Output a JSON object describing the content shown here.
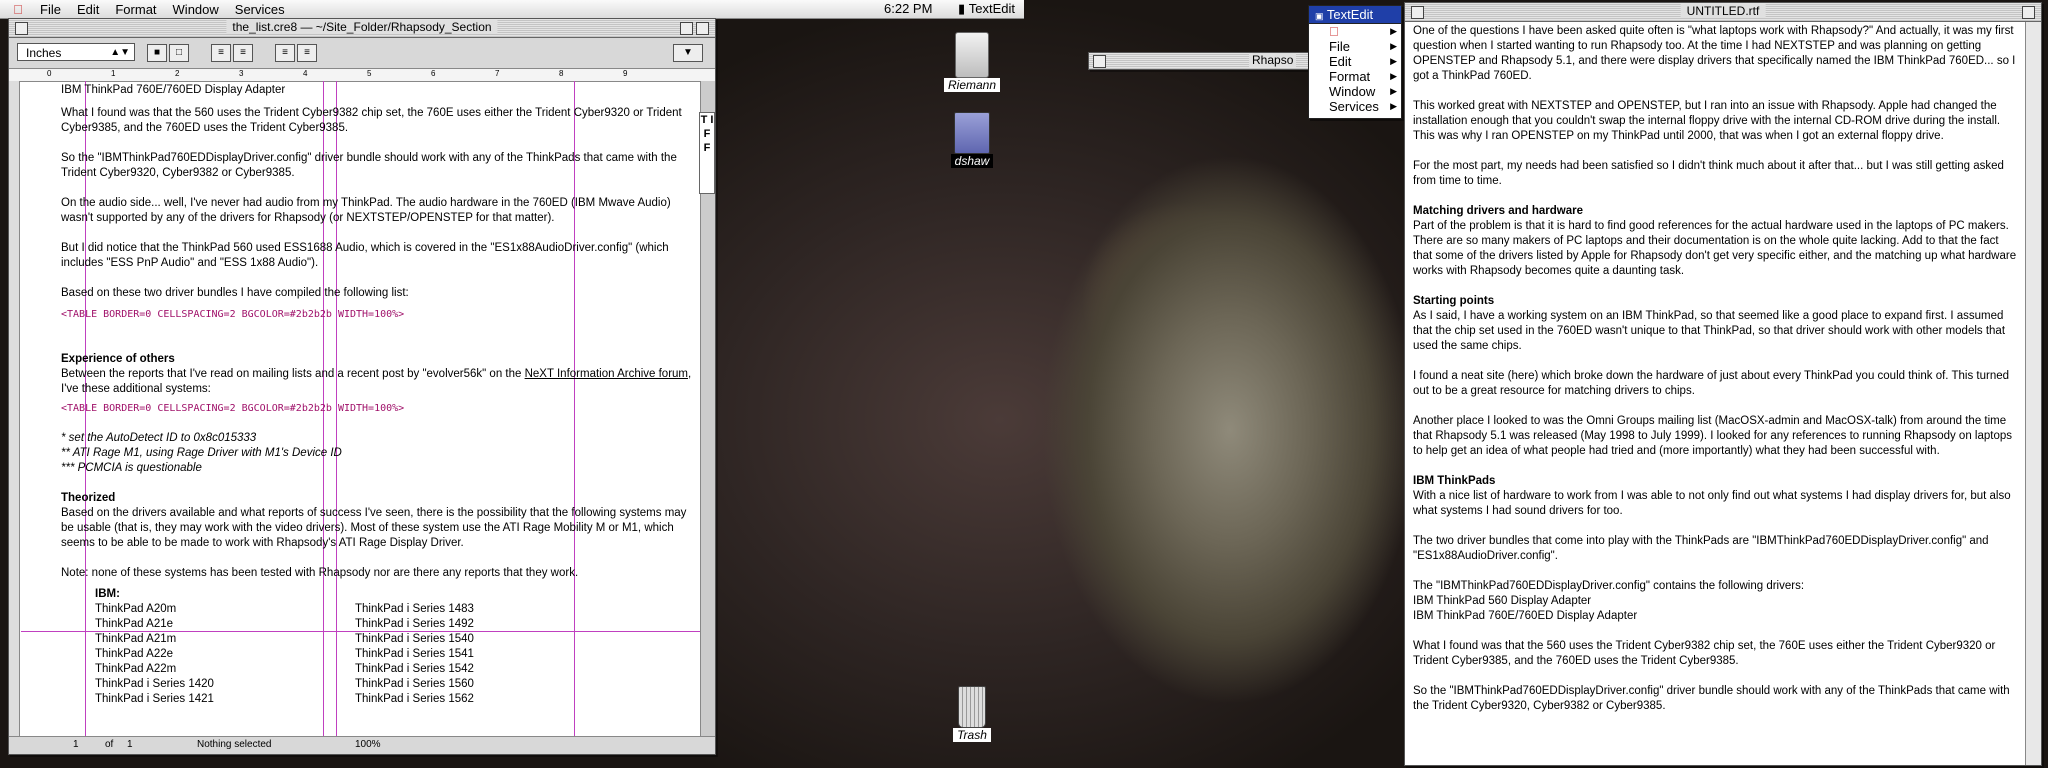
{
  "menubar": {
    "items": [
      "File",
      "Edit",
      "Format",
      "Window",
      "Services"
    ],
    "clock": "6:22 PM",
    "active_app": "TextEdit"
  },
  "editor": {
    "title": "the_list.cre8 — ~/Site_Folder/Rhapsody_Section",
    "units": "Inches",
    "ruler": [
      "0",
      "1",
      "2",
      "3",
      "4",
      "5",
      "6",
      "7",
      "8",
      "9"
    ],
    "tiff": "T I F F",
    "paragraphs": [
      "IBM ThinkPad 760E/760ED Display Adapter",
      "What I found was that the 560 uses the Trident Cyber9382 chip set, the 760E uses either the Trident Cyber9320 or Trident Cyber9385, and the 760ED uses the Trident Cyber9385.",
      "So the \"IBMThinkPad760EDDisplayDriver.config\" driver bundle should work with any of the ThinkPads that came with the Trident Cyber9320, Cyber9382 or Cyber9385.",
      "On the audio side... well, I've never had audio from my ThinkPad. The audio hardware in the 760ED (IBM Mwave Audio) wasn't supported by any of the drivers for Rhapsody (or NEXTSTEP/OPENSTEP for that matter).",
      "But I did notice that the ThinkPad 560 used ESS1688 Audio, which is covered in the \"ES1x88AudioDriver.config\" (which includes \"ESS PnP Audio\" and \"ESS 1x88 Audio\").",
      "Based on these two driver bundles I have compiled the following list:"
    ],
    "code1": "<TABLE BORDER=0 CELLSPACING=2 BGCOLOR=#2b2b2b WIDTH=100%>",
    "heading_others": "Experience of others",
    "others_text": "Between the reports that I've read on mailing lists and a recent post by \"evolver56k\" on the ",
    "others_link": "NeXT Information Archive forum",
    "others_tail": ", I've these additional systems:",
    "code2": "<TABLE BORDER=0 CELLSPACING=2 BGCOLOR=#2b2b2b WIDTH=100%>",
    "notes": [
      "* set the AutoDetect ID to 0x8c015333",
      "** ATI Rage M1, using Rage Driver with M1's Device ID",
      "*** PCMCIA is questionable"
    ],
    "heading_theorized": "Theorized",
    "theorized_text": "Based on the drivers available and what reports of success I've seen, there is the possibility that the following systems may be usable (that is, they may work with the video drivers). Most of these system use the ATI Rage Mobility M or M1, which seems to be able to be made to work with Rhapsody's ATI Rage Display Driver.",
    "note_text": "Note: none of these systems has been tested with Rhapsody nor are there any reports that they work.",
    "ibm_label": "IBM:",
    "ibm_col1": [
      "ThinkPad A20m",
      "ThinkPad A21e",
      "ThinkPad A21m",
      "ThinkPad A22e",
      "ThinkPad A22m",
      "ThinkPad i Series 1420",
      "ThinkPad i Series 1421"
    ],
    "ibm_col2": [
      "ThinkPad i Series 1483",
      "ThinkPad i Series 1492",
      "ThinkPad i Series 1540",
      "ThinkPad i Series 1541",
      "ThinkPad i Series 1542",
      "ThinkPad i Series 1560",
      "ThinkPad i Series 1562"
    ],
    "status": {
      "page": "1",
      "of": "of",
      "total": "1",
      "selection": "Nothing selected",
      "zoom": "100%"
    }
  },
  "desktop_icons": [
    {
      "label": "Riemann"
    },
    {
      "label": "dshaw"
    },
    {
      "label": "Trash"
    }
  ],
  "hidden_window_title": "Rhapso",
  "textedit_menu": {
    "header": "TextEdit",
    "items": [
      "File",
      "Edit",
      "Format",
      "Window",
      "Services"
    ]
  },
  "rtf": {
    "title": "UNTITLED.rtf",
    "blocks": [
      {
        "type": "p",
        "text": "One of the questions I have been asked quite often is \"what laptops work with Rhapsody?\" And actually, it was my first question when I started wanting to run Rhapsody too. At the time I had NEXTSTEP and was planning on getting OPENSTEP and Rhapsody 5.1, and there were display drivers that specifically named the IBM ThinkPad 760ED... so I got a ThinkPad 760ED."
      },
      {
        "type": "p",
        "text": "This worked great with NEXTSTEP and OPENSTEP, but I ran into an issue with Rhapsody. Apple had changed the installation enough that you couldn't swap the internal floppy drive with the internal CD-ROM drive during the install. This was why I ran OPENSTEP on my ThinkPad until 2000, that was when I got an external floppy drive."
      },
      {
        "type": "p",
        "text": "For the most part, my needs had been satisfied so I didn't think much about it after that... but I was still getting asked from time to time."
      },
      {
        "type": "h",
        "text": "Matching drivers and hardware"
      },
      {
        "type": "p",
        "text": "Part of the problem is that it is hard to find good references for the actual hardware used in the laptops of PC makers. There are so many makers of PC laptops and their documentation is on the whole quite lacking. Add to that the fact that some of the drivers listed by Apple for Rhapsody don't get very specific either, and the matching up what hardware works with Rhapsody becomes quite a daunting task."
      },
      {
        "type": "h",
        "text": "Starting points"
      },
      {
        "type": "p",
        "text": "As I said, I have a working system on an IBM ThinkPad, so that seemed like a good place to expand first. I assumed that the chip set used in the 760ED wasn't unique to that ThinkPad, so that driver should work with other models that used the same chips."
      },
      {
        "type": "p",
        "text": "I found a neat site (here) which broke down the hardware of just about every ThinkPad you could think of. This turned out to be a great resource for matching drivers to chips."
      },
      {
        "type": "p",
        "text": "Another place I looked to was the Omni Groups mailing list (MacOSX-admin and MacOSX-talk) from around the time that Rhapsody 5.1 was released (May 1998 to July 1999). I looked for any references to running Rhapsody on laptops to help get an idea of what people had tried and (more importantly) what they had been successful with."
      },
      {
        "type": "h",
        "text": "IBM ThinkPads"
      },
      {
        "type": "p",
        "text": "With a nice list of hardware to work from I was able to not only find out what systems I had display drivers for, but also what systems I had sound drivers for too."
      },
      {
        "type": "p",
        "text": "The two driver bundles that come into play with the ThinkPads are \"IBMThinkPad760EDDisplayDriver.config\" and \"ES1x88AudioDriver.config\"."
      },
      {
        "type": "line",
        "text": "The \"IBMThinkPad760EDDisplayDriver.config\" contains the following drivers:"
      },
      {
        "type": "line",
        "text": "IBM ThinkPad 560 Display Adapter"
      },
      {
        "type": "p",
        "text": "IBM ThinkPad 760E/760ED Display Adapter"
      },
      {
        "type": "p",
        "text": "What I found was that the 560 uses the Trident Cyber9382 chip set, the 760E uses either the Trident Cyber9320 or Trident Cyber9385, and the 760ED uses the Trident Cyber9385."
      },
      {
        "type": "p",
        "text": "So the \"IBMThinkPad760EDDisplayDriver.config\" driver bundle should work with any of the ThinkPads that came with the Trident Cyber9320, Cyber9382 or Cyber9385."
      }
    ]
  },
  "colors": {
    "link_code": "#a0126a",
    "guide": "#c040c0",
    "menu_highlight": "#1f3fa8"
  }
}
